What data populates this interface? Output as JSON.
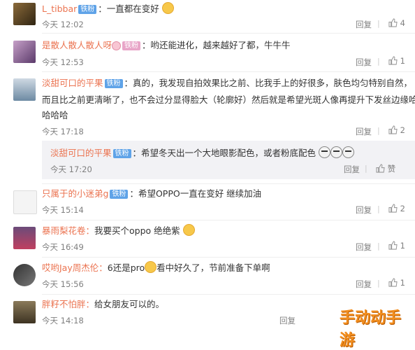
{
  "comments": [
    {
      "user": "L_tibbar",
      "badge": "铁粉",
      "text": "一直都在变好",
      "time": "今天 12:02",
      "reply": "回复",
      "likes": "4"
    },
    {
      "user": "是散人散人散人呀",
      "badge": "铁粉",
      "text": "哟还能进化，越来越好了都，牛牛牛",
      "time": "今天 12:53",
      "reply": "回复",
      "likes": "1"
    },
    {
      "user": "淡甜可口的平果",
      "badge": "铁粉",
      "text1": "真的，我发现自拍效果比之前、比我手上的好很多，肤色均匀特别自然，",
      "text2": "而且比之前更清晰了，也不会过分显得脸大（轮廓好）然后就是希望光斑人像再提升下发丝边缘哈",
      "text3": "哈哈哈",
      "time": "今天 17:18",
      "reply": "回复",
      "likes": "2"
    },
    {
      "user": "淡甜可口的平果",
      "badge": "铁粉",
      "text": "希望冬天出一个大地眼影配色，或者粉底配色",
      "time": "今天 17:20",
      "reply": "回复",
      "likes": "赞"
    },
    {
      "user": "只属于的小迷弟g",
      "badge": "铁粉",
      "text": "希望OPPO一直在变好 继续加油",
      "time": "今天 15:14",
      "reply": "回复",
      "likes": "2"
    },
    {
      "user": "暴雨梨花卷：",
      "text": "我要买个oppo 绝绝紫",
      "time": "今天 16:49",
      "reply": "回复",
      "likes": "1"
    },
    {
      "user": "哎哟Jay周杰伦：",
      "text1": "6还是pro",
      "text2": "看中好久了，节前准备下单啊",
      "time": "今天 15:56",
      "reply": "回复",
      "likes": "1"
    },
    {
      "user": "胖籽不怕胖：",
      "text": "给女朋友可以的。",
      "time": "今天 14:18",
      "reply": "回复"
    }
  ],
  "watermark": "手动动手游"
}
